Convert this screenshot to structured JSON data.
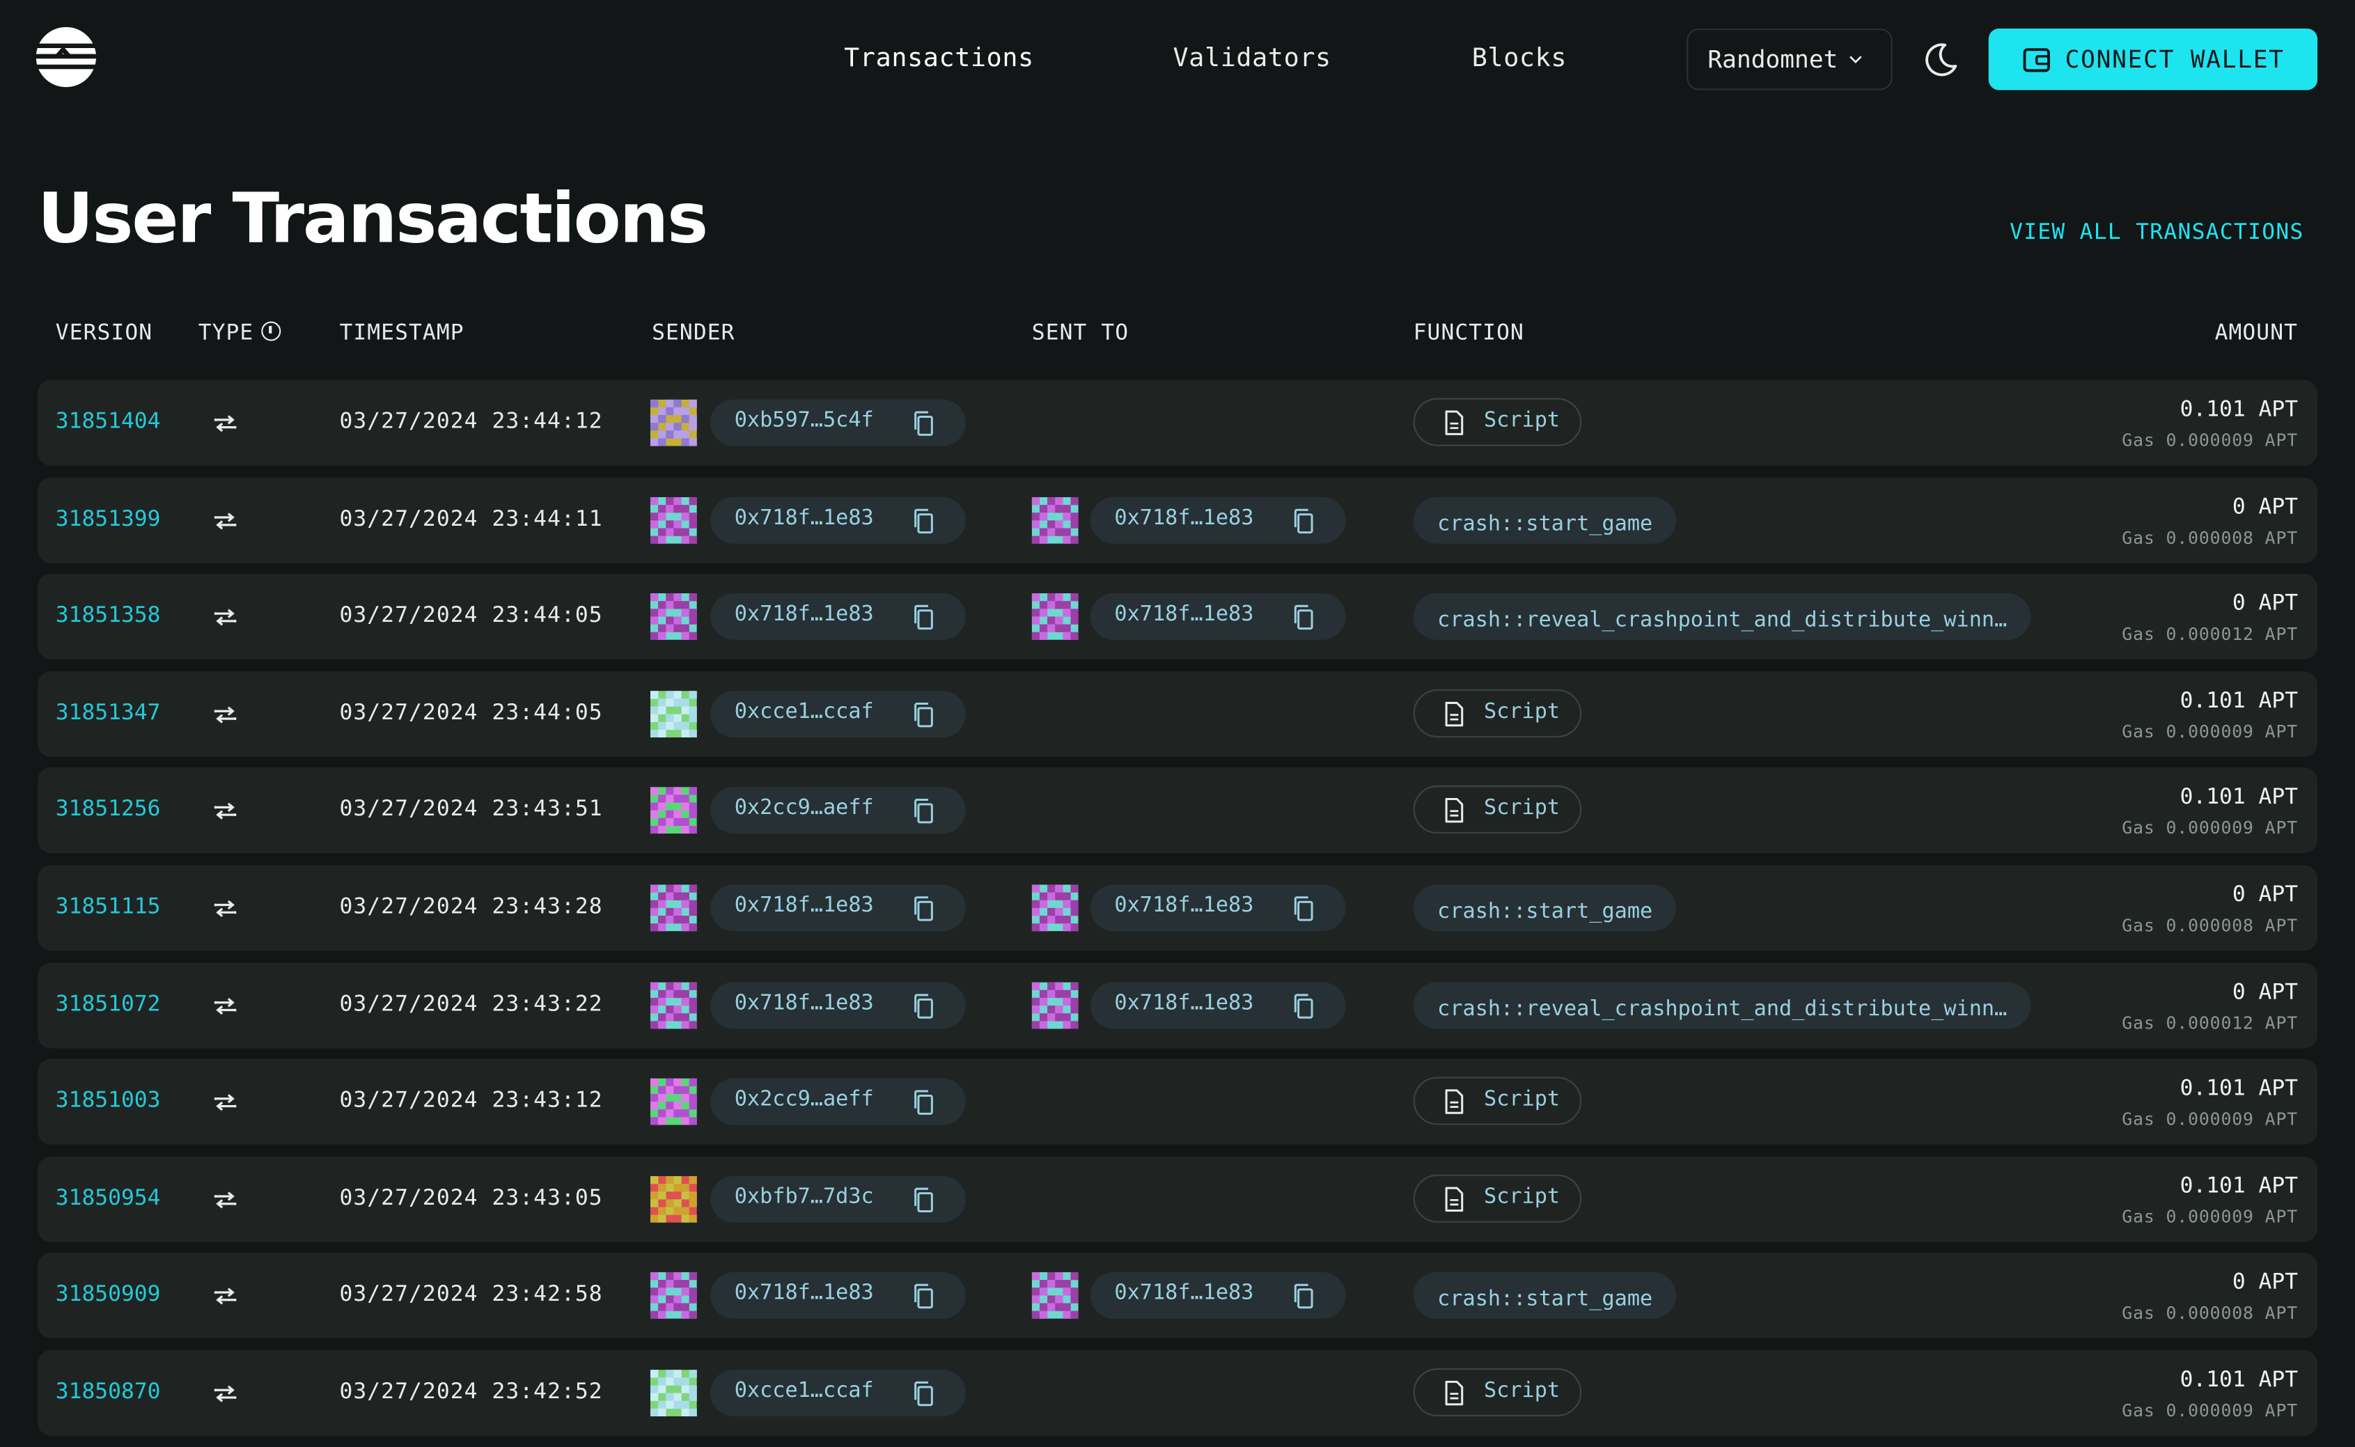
{
  "header": {
    "nav": [
      "Transactions",
      "Validators",
      "Blocks"
    ],
    "network": "Randomnet",
    "connect_wallet": "CONNECT WALLET"
  },
  "page": {
    "title": "User Transactions",
    "view_all": "VIEW ALL TRANSACTIONS"
  },
  "table": {
    "columns": {
      "version": "VERSION",
      "type": "TYPE",
      "timestamp": "TIMESTAMP",
      "sender": "SENDER",
      "sent_to": "SENT TO",
      "function": "FUNCTION",
      "amount": "AMOUNT"
    },
    "rows": [
      {
        "version": "31851404",
        "timestamp": "03/27/2024 23:44:12",
        "sender": "0xb597…5c4f",
        "sent_to": "",
        "function": "Script",
        "amount": "0.101 APT",
        "gas": "Gas 0.000009 APT"
      },
      {
        "version": "31851399",
        "timestamp": "03/27/2024 23:44:11",
        "sender": "0x718f…1e83",
        "sent_to": "0x718f…1e83",
        "function": "crash::start_game",
        "amount": "0 APT",
        "gas": "Gas 0.000008 APT"
      },
      {
        "version": "31851358",
        "timestamp": "03/27/2024 23:44:05",
        "sender": "0x718f…1e83",
        "sent_to": "0x718f…1e83",
        "function": "crash::reveal_crashpoint_and_distribute_winn…",
        "amount": "0 APT",
        "gas": "Gas 0.000012 APT"
      },
      {
        "version": "31851347",
        "timestamp": "03/27/2024 23:44:05",
        "sender": "0xcce1…ccaf",
        "sent_to": "",
        "function": "Script",
        "amount": "0.101 APT",
        "gas": "Gas 0.000009 APT"
      },
      {
        "version": "31851256",
        "timestamp": "03/27/2024 23:43:51",
        "sender": "0x2cc9…aeff",
        "sent_to": "",
        "function": "Script",
        "amount": "0.101 APT",
        "gas": "Gas 0.000009 APT"
      },
      {
        "version": "31851115",
        "timestamp": "03/27/2024 23:43:28",
        "sender": "0x718f…1e83",
        "sent_to": "0x718f…1e83",
        "function": "crash::start_game",
        "amount": "0 APT",
        "gas": "Gas 0.000008 APT"
      },
      {
        "version": "31851072",
        "timestamp": "03/27/2024 23:43:22",
        "sender": "0x718f…1e83",
        "sent_to": "0x718f…1e83",
        "function": "crash::reveal_crashpoint_and_distribute_winn…",
        "amount": "0 APT",
        "gas": "Gas 0.000012 APT"
      },
      {
        "version": "31851003",
        "timestamp": "03/27/2024 23:43:12",
        "sender": "0x2cc9…aeff",
        "sent_to": "",
        "function": "Script",
        "amount": "0.101 APT",
        "gas": "Gas 0.000009 APT"
      },
      {
        "version": "31850954",
        "timestamp": "03/27/2024 23:43:05",
        "sender": "0xbfb7…7d3c",
        "sent_to": "",
        "function": "Script",
        "amount": "0.101 APT",
        "gas": "Gas 0.000009 APT"
      },
      {
        "version": "31850909",
        "timestamp": "03/27/2024 23:42:58",
        "sender": "0x718f…1e83",
        "sent_to": "0x718f…1e83",
        "function": "crash::start_game",
        "amount": "0 APT",
        "gas": "Gas 0.000008 APT"
      },
      {
        "version": "31850870",
        "timestamp": "03/27/2024 23:42:52",
        "sender": "0xcce1…ccaf",
        "sent_to": "",
        "function": "Script",
        "amount": "0.101 APT",
        "gas": "Gas 0.000009 APT"
      }
    ]
  },
  "colors": {
    "accent": "#1ee4f0",
    "background": "#131616",
    "row": "#1f2423",
    "link": "#26c8d6"
  },
  "icons": [
    "logo-icon",
    "chevron-down-icon",
    "moon-icon",
    "wallet-icon",
    "info-icon",
    "transfer-icon",
    "copy-icon",
    "document-icon",
    "identicon"
  ]
}
